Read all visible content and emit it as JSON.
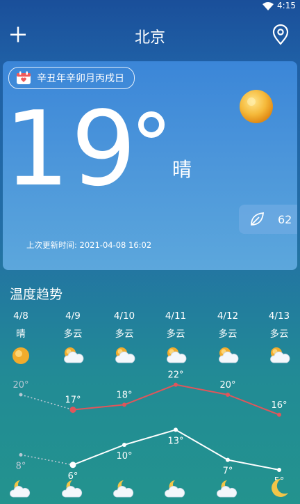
{
  "status_bar": {
    "time": "4:15",
    "wifi_icon": "wifi-icon"
  },
  "header": {
    "city": "北京",
    "add_icon": "plus-icon",
    "location_icon": "location-pin-icon"
  },
  "current": {
    "lunar_date": "辛丑年辛卯月丙戌日",
    "temperature": "19",
    "condition": "晴",
    "aqi": "62",
    "updated_label": "上次更新时间:",
    "updated_time": "2021-04-08 16:02"
  },
  "trend": {
    "title": "温度趋势",
    "days": [
      {
        "date": "4/8",
        "cond": "晴",
        "icon": "sun-icon"
      },
      {
        "date": "4/9",
        "cond": "多云",
        "icon": "partly-cloudy-icon"
      },
      {
        "date": "4/10",
        "cond": "多云",
        "icon": "partly-cloudy-icon"
      },
      {
        "date": "4/11",
        "cond": "多云",
        "icon": "partly-cloudy-icon"
      },
      {
        "date": "4/12",
        "cond": "多云",
        "icon": "partly-cloudy-icon"
      },
      {
        "date": "4/13",
        "cond": "多云",
        "icon": "partly-cloudy-icon"
      }
    ],
    "high_labels": [
      "20°",
      "17°",
      "18°",
      "22°",
      "20°",
      "16°"
    ],
    "low_labels": [
      "8°",
      "6°",
      "10°",
      "13°",
      "7°",
      "5°"
    ],
    "night_icons": [
      "night-cloudy-icon",
      "night-cloudy-icon",
      "night-cloudy-icon",
      "night-cloudy-icon",
      "night-cloudy-icon",
      "moon-icon"
    ]
  },
  "chart_data": {
    "type": "line",
    "categories": [
      "4/8",
      "4/9",
      "4/10",
      "4/11",
      "4/12",
      "4/13"
    ],
    "series": [
      {
        "values": [
          20,
          17,
          18,
          22,
          20,
          16
        ],
        "color": "#e0565b"
      },
      {
        "values": [
          8,
          6,
          10,
          13,
          7,
          5
        ],
        "color": "#ffffff"
      }
    ],
    "past_segment_color": "#b7c8d4"
  },
  "colors": {
    "high_line": "#e0565b",
    "low_line": "#ffffff",
    "card_top": "#3b86d8"
  }
}
